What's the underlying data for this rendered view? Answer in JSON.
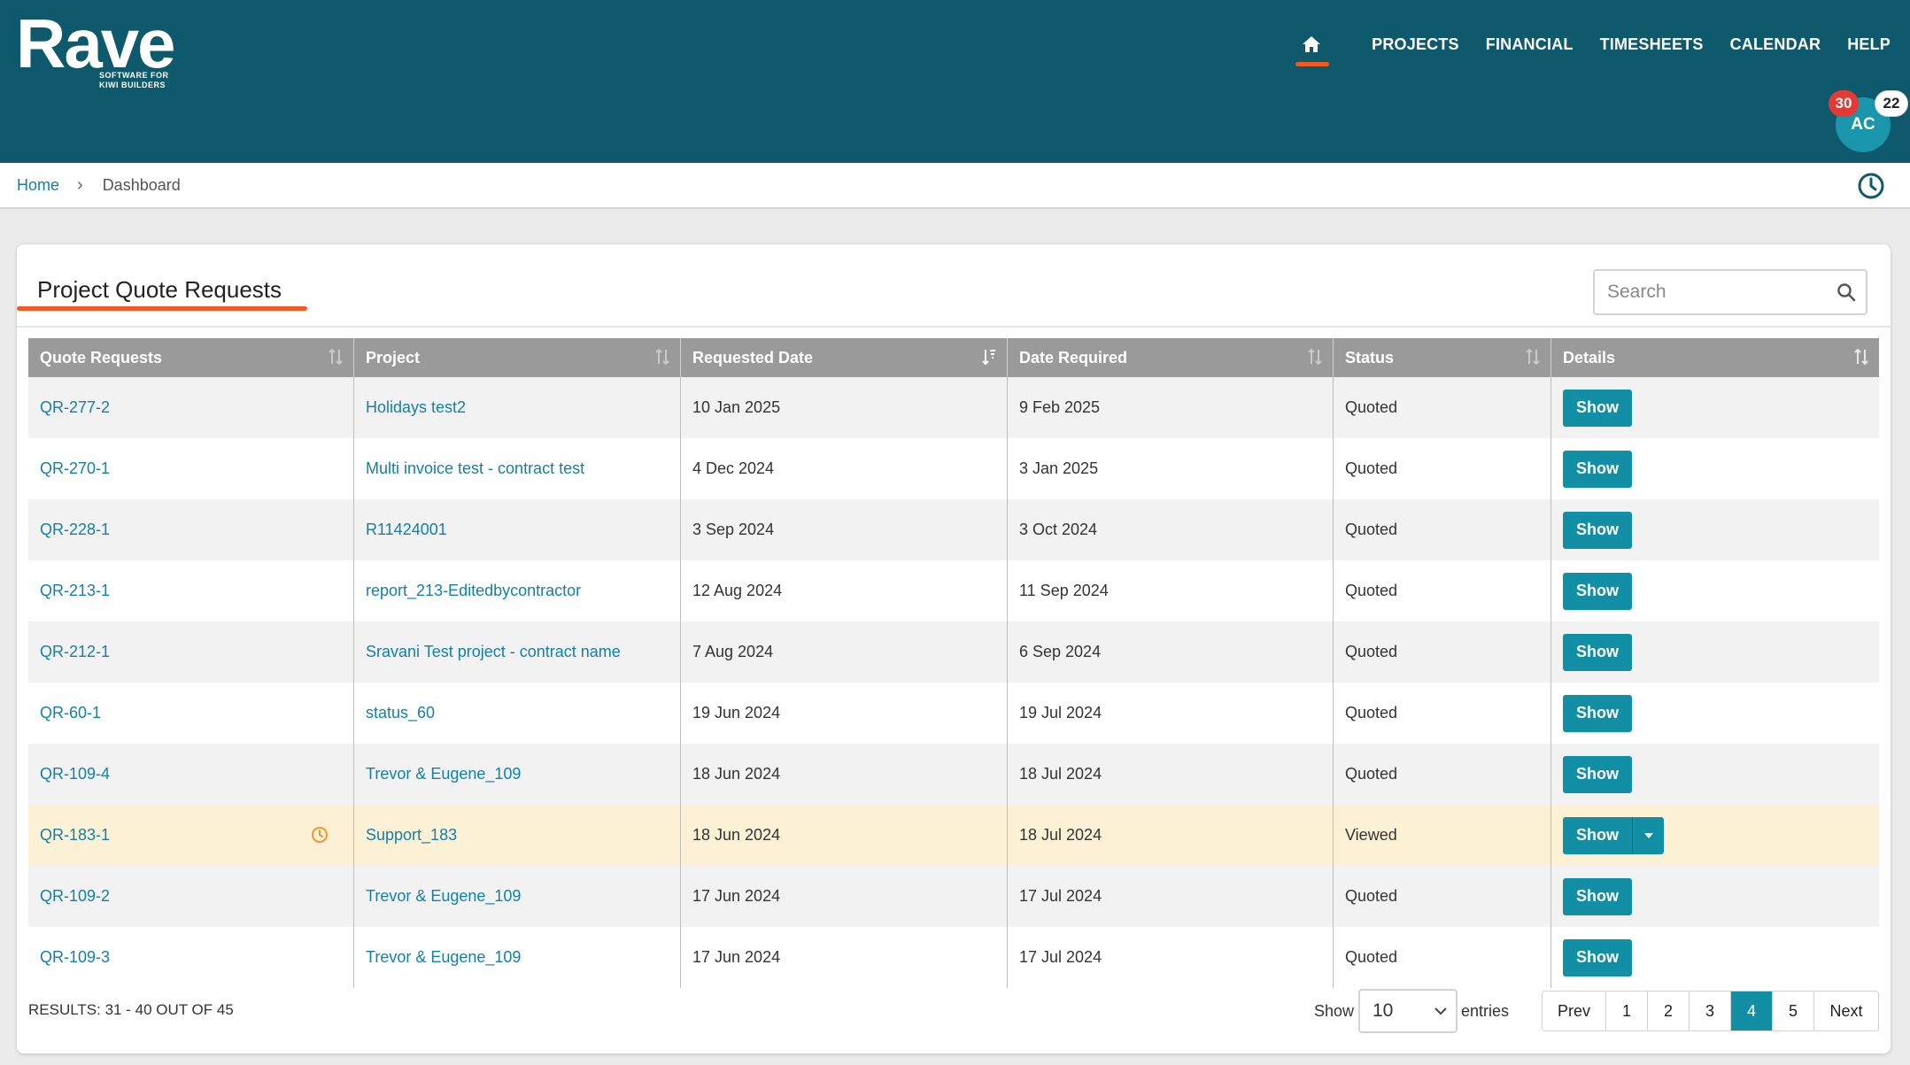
{
  "brand": {
    "name": "Rave",
    "tagline_line1": "SOFTWARE FOR",
    "tagline_line2": "KIWI BUILDERS"
  },
  "nav": {
    "items": [
      "PROJECTS",
      "FINANCIAL",
      "TIMESHEETS",
      "CALENDAR",
      "HELP"
    ],
    "home_icon": "home-icon"
  },
  "user": {
    "initials": "AC",
    "badge_red": "30",
    "badge_white": "22"
  },
  "breadcrumb": {
    "home": "Home",
    "separator": "›",
    "current": "Dashboard"
  },
  "panel": {
    "title": "Project Quote Requests"
  },
  "search": {
    "placeholder": "Search"
  },
  "table": {
    "columns": [
      "Quote Requests",
      "Project",
      "Requested Date",
      "Date Required",
      "Status",
      "Details"
    ],
    "rows": [
      {
        "quote": "QR-277-2",
        "project": "Holidays test2",
        "requested": "10 Jan 2025",
        "required": "9 Feb 2025",
        "status": "Quoted",
        "action": "Show"
      },
      {
        "quote": "QR-270-1",
        "project": "Multi invoice test - contract test",
        "requested": "4 Dec 2024",
        "required": "3 Jan 2025",
        "status": "Quoted",
        "action": "Show"
      },
      {
        "quote": "QR-228-1",
        "project": "R11424001",
        "requested": "3 Sep 2024",
        "required": "3 Oct 2024",
        "status": "Quoted",
        "action": "Show"
      },
      {
        "quote": "QR-213-1",
        "project": "report_213-Editedbycontractor",
        "requested": "12 Aug 2024",
        "required": "11 Sep 2024",
        "status": "Quoted",
        "action": "Show"
      },
      {
        "quote": "QR-212-1",
        "project": "Sravani Test project - contract name",
        "requested": "7 Aug 2024",
        "required": "6 Sep 2024",
        "status": "Quoted",
        "action": "Show"
      },
      {
        "quote": "QR-60-1",
        "project": "status_60",
        "requested": "19 Jun 2024",
        "required": "19 Jul 2024",
        "status": "Quoted",
        "action": "Show"
      },
      {
        "quote": "QR-109-4",
        "project": "Trevor & Eugene_109",
        "requested": "18 Jun 2024",
        "required": "18 Jul 2024",
        "status": "Quoted",
        "action": "Show"
      },
      {
        "quote": "QR-183-1",
        "project": "Support_183",
        "requested": "18 Jun 2024",
        "required": "18 Jul 2024",
        "status": "Viewed",
        "action": "Show"
      },
      {
        "quote": "QR-109-2",
        "project": "Trevor & Eugene_109",
        "requested": "17 Jun 2024",
        "required": "17 Jul 2024",
        "status": "Quoted",
        "action": "Show"
      },
      {
        "quote": "QR-109-3",
        "project": "Trevor & Eugene_109",
        "requested": "17 Jun 2024",
        "required": "17 Jul 2024",
        "status": "Quoted",
        "action": "Show"
      }
    ]
  },
  "footer": {
    "results": "RESULTS: 31 - 40 OUT OF 45",
    "show_label": "Show",
    "entries_value": "10",
    "entries_label": "entries",
    "pagination": {
      "prev": "Prev",
      "pages": [
        "1",
        "2",
        "3",
        "4",
        "5"
      ],
      "active_page": "4",
      "next": "Next"
    }
  },
  "colors": {
    "header_bg": "#0e596c",
    "accent_orange": "#f05a22",
    "button_teal": "#138fa5",
    "link_blue": "#1480a8",
    "table_header_bg": "#9a9a9a",
    "highlight_row": "#fdf1d5",
    "badge_red": "#e53935"
  }
}
